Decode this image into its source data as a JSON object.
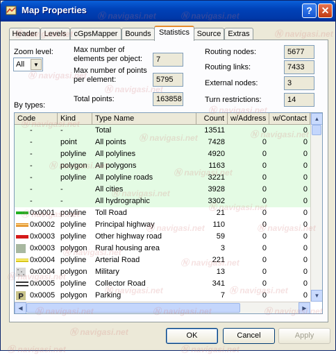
{
  "window": {
    "title": "Map Properties"
  },
  "titlebar_buttons": {
    "help": "?",
    "close": "✕"
  },
  "tabs": [
    "Header",
    "Levels",
    "cGpsMapper",
    "Bounds",
    "Statistics",
    "Source",
    "Extras"
  ],
  "active_tab": "Statistics",
  "zoom": {
    "label": "Zoom level:",
    "value": "All"
  },
  "stats_left": {
    "max_elements_label_1": "Max number of",
    "max_elements_label_2": "elements per object:",
    "max_elements_value": "7",
    "max_points_label_1": "Max number of points",
    "max_points_label_2": "per element:",
    "max_points_value": "5795",
    "total_points_label": "Total points:",
    "total_points_value": "163858"
  },
  "stats_right": {
    "routing_nodes_label": "Routing nodes:",
    "routing_nodes_value": "5677",
    "routing_links_label": "Routing links:",
    "routing_links_value": "7433",
    "external_nodes_label": "External nodes:",
    "external_nodes_value": "3",
    "turn_restrictions_label": "Turn restrictions:",
    "turn_restrictions_value": "14"
  },
  "by_types_label": "By types:",
  "table": {
    "columns": [
      "Code",
      "Kind",
      "Type Name",
      "Count",
      "w/Address",
      "w/Contact"
    ],
    "rows": [
      {
        "code": "-",
        "kind": "-",
        "name": "Total",
        "count": "13511",
        "addr": "0",
        "contact": "0",
        "summary": true,
        "swatch": ""
      },
      {
        "code": "-",
        "kind": "point",
        "name": "All points",
        "count": "7428",
        "addr": "0",
        "contact": "0",
        "summary": true,
        "swatch": ""
      },
      {
        "code": "-",
        "kind": "polyline",
        "name": "All polylines",
        "count": "4920",
        "addr": "0",
        "contact": "0",
        "summary": true,
        "swatch": ""
      },
      {
        "code": "-",
        "kind": "polygon",
        "name": "All polygons",
        "count": "1163",
        "addr": "0",
        "contact": "0",
        "summary": true,
        "swatch": ""
      },
      {
        "code": "-",
        "kind": "polyline",
        "name": "All polyline roads",
        "count": "3221",
        "addr": "0",
        "contact": "0",
        "summary": true,
        "swatch": ""
      },
      {
        "code": "-",
        "kind": "-",
        "name": "All cities",
        "count": "3928",
        "addr": "0",
        "contact": "0",
        "summary": true,
        "swatch": ""
      },
      {
        "code": "-",
        "kind": "-",
        "name": "All hydrographic",
        "count": "3302",
        "addr": "0",
        "contact": "0",
        "summary": true,
        "swatch": ""
      },
      {
        "code": "0x0001",
        "kind": "polyline",
        "name": "Toll Road",
        "count": "21",
        "addr": "0",
        "contact": "0",
        "summary": false,
        "swatch": "line-green"
      },
      {
        "code": "0x0002",
        "kind": "polyline",
        "name": "Principal highway",
        "count": "110",
        "addr": "0",
        "contact": "0",
        "summary": false,
        "swatch": "line-orange"
      },
      {
        "code": "0x0003",
        "kind": "polyline",
        "name": "Other highway road",
        "count": "59",
        "addr": "0",
        "contact": "0",
        "summary": false,
        "swatch": "line-red"
      },
      {
        "code": "0x0003",
        "kind": "polygon",
        "name": "Rural housing area",
        "count": "3",
        "addr": "0",
        "contact": "0",
        "summary": false,
        "swatch": "fill-gray"
      },
      {
        "code": "0x0004",
        "kind": "polyline",
        "name": "Arterial Road",
        "count": "221",
        "addr": "0",
        "contact": "0",
        "summary": false,
        "swatch": "line-yellow"
      },
      {
        "code": "0x0004",
        "kind": "polygon",
        "name": "Military",
        "count": "13",
        "addr": "0",
        "contact": "0",
        "summary": false,
        "swatch": "fill-dots"
      },
      {
        "code": "0x0005",
        "kind": "polyline",
        "name": "Collector Road",
        "count": "341",
        "addr": "0",
        "contact": "0",
        "summary": false,
        "swatch": "line-double"
      },
      {
        "code": "0x0005",
        "kind": "polygon",
        "name": "Parking",
        "count": "7",
        "addr": "0",
        "contact": "0",
        "summary": false,
        "swatch": "parking-p"
      }
    ]
  },
  "buttons": {
    "ok": "OK",
    "cancel": "Cancel",
    "apply": "Apply"
  },
  "watermark_text": "navigasi.net"
}
